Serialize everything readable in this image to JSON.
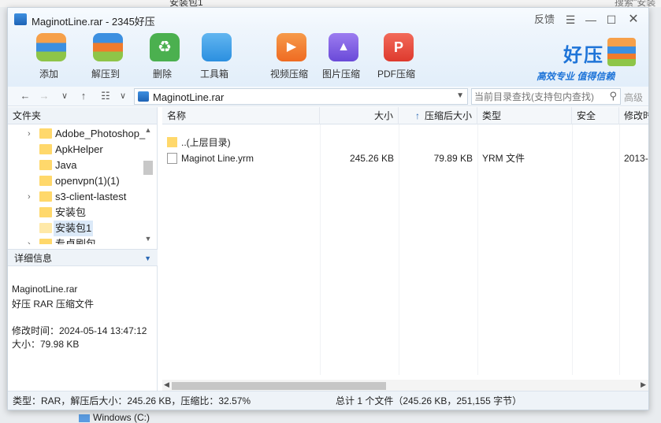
{
  "background": {
    "top_left_text": "安装包1",
    "top_right_text": "搜索\"安装",
    "bottom_taskbar_text": "Windows (C:)"
  },
  "window": {
    "title": "MaginotLine.rar - 2345好压",
    "feedback_label": "反馈",
    "menu_icon": "menu-icon",
    "minimize_icon": "minimize-icon",
    "maximize_icon": "maximize-icon",
    "close_icon": "close-icon"
  },
  "toolbar": {
    "items": [
      {
        "label": "添加",
        "color": "#e8503a"
      },
      {
        "label": "解压到",
        "color": "#3b8fe0"
      },
      {
        "label": "删除",
        "color": "#4bb04f"
      },
      {
        "label": "工具箱",
        "color": "#3aa0e8"
      },
      {
        "label": "视频压缩",
        "color": "#f07b2c"
      },
      {
        "label": "图片压缩",
        "color": "#7e57e0"
      },
      {
        "label": "PDF压缩",
        "color": "#e8433a"
      }
    ],
    "brand_name": "好压",
    "brand_slogan": "高效专业  值得信赖"
  },
  "address": {
    "back": "←",
    "forward": "→",
    "history": "∨",
    "up": "↑",
    "view": "☷",
    "view_drop": "∨",
    "path": "MaginotLine.rar",
    "search_placeholder": "当前目录查找(支持包内查找)",
    "advanced_label": "高级"
  },
  "sidebar": {
    "header": "文件夹",
    "folders": [
      {
        "label": "Adobe_Photoshop_",
        "expandable": true
      },
      {
        "label": "ApkHelper",
        "expandable": false
      },
      {
        "label": "Java",
        "expandable": false
      },
      {
        "label": "openvpn(1)(1)",
        "expandable": false
      },
      {
        "label": "s3-client-lastest",
        "expandable": true
      },
      {
        "label": "安装包",
        "expandable": false
      },
      {
        "label": "安装包1",
        "expandable": false,
        "selected": true
      },
      {
        "label": "专卓刷包",
        "expandable": true
      }
    ]
  },
  "details": {
    "header": "详细信息",
    "filename": "MaginotLine.rar",
    "filetype": "好压 RAR 压缩文件",
    "modified": "修改时间：2024-05-14 13:47:12",
    "size": "大小：79.98 KB"
  },
  "file_list": {
    "columns": [
      "名称",
      "大小",
      "压缩后大小",
      "类型",
      "安全",
      "修改时"
    ],
    "sort_indicator": "↑",
    "parent_row": "..(上层目录)",
    "rows": [
      {
        "name": "Maginot Line.yrm",
        "size": "245.26 KB",
        "packed": "79.89 KB",
        "type": "YRM 文件",
        "security": "",
        "modified": "2013-"
      }
    ]
  },
  "status": {
    "left": "类型：RAR，解压后大小：245.26 KB，压缩比：32.57%",
    "right": "总计 1 个文件（245.26 KB，251,155 字节）"
  }
}
